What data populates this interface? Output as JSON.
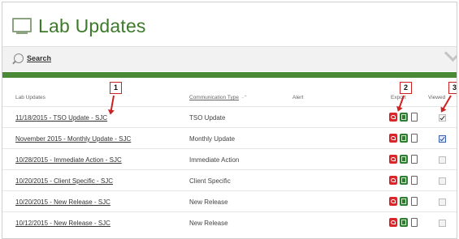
{
  "header": {
    "title": "Lab Updates",
    "icon": "monitor-icon"
  },
  "search": {
    "label": "Search",
    "icon": "search-icon"
  },
  "table": {
    "columns": {
      "lab_updates": "Lab Updates",
      "communication_type": "Communication Type",
      "alert": "Alert",
      "export": "Export",
      "viewed": "Viewed"
    },
    "rows": [
      {
        "title": "11/18/2015 - TSO Update - SJC",
        "type": "TSO Update",
        "viewed": "checked"
      },
      {
        "title": "November 2015 - Monthly Update - SJC",
        "type": "Monthly Update",
        "viewed": "checked-blue"
      },
      {
        "title": "10/28/2015 - Immediate Action - SJC",
        "type": "Immediate Action",
        "viewed": "unchecked"
      },
      {
        "title": "10/20/2015 - Client Specific - SJC",
        "type": "Client Specific",
        "viewed": "unchecked"
      },
      {
        "title": "10/20/2015 - New Release - SJC",
        "type": "New Release",
        "viewed": "unchecked"
      },
      {
        "title": "10/12/2015 - New Release - SJC",
        "type": "New Release",
        "viewed": "unchecked"
      }
    ]
  },
  "callouts": [
    "1",
    "2",
    "3"
  ],
  "colors": {
    "accent": "#4a8a36",
    "title": "#3c7a2a",
    "callout": "#cc2222",
    "pdf": "#d9262a",
    "xls": "#2e7d32"
  }
}
